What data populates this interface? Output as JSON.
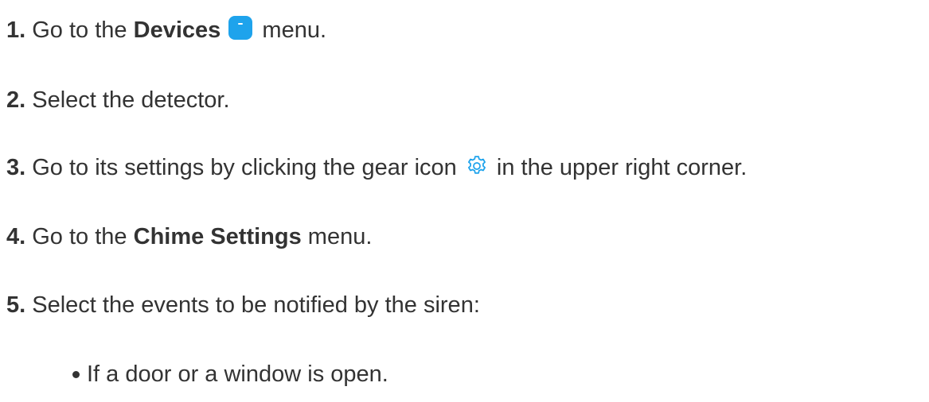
{
  "steps": [
    {
      "number": "1.",
      "before": "Go to the",
      "bold": "Devices",
      "after": "menu.",
      "icon": "devices-icon"
    },
    {
      "number": "2.",
      "text": "Select the detector."
    },
    {
      "number": "3.",
      "before": "Go to its settings by clicking the gear icon",
      "after": "in the upper right corner.",
      "icon": "gear-icon"
    },
    {
      "number": "4.",
      "before": "Go to the",
      "bold": "Chime Settings",
      "after": "menu."
    },
    {
      "number": "5.",
      "text": "Select the events to be notified by the siren:"
    }
  ],
  "bullets": [
    "If a door or a window is open."
  ],
  "colors": {
    "text": "#333333",
    "accent": "#1ea3ec"
  }
}
